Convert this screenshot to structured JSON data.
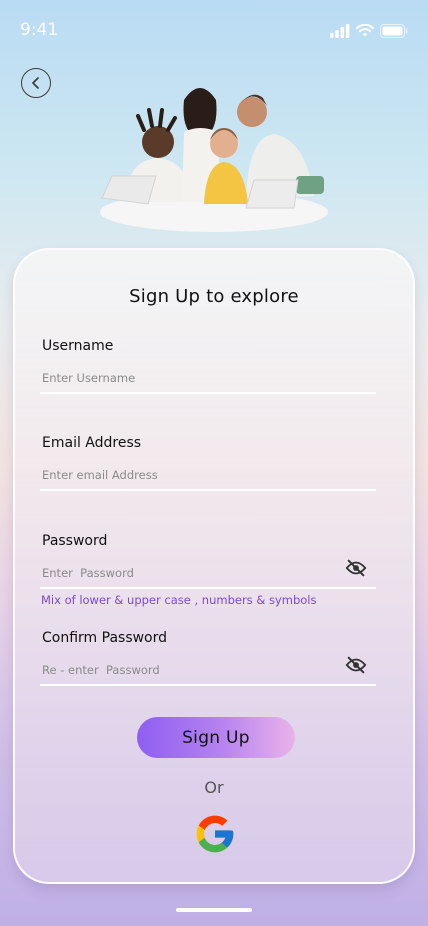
{
  "status_bar": {
    "time": "9:41"
  },
  "header": {
    "back_icon": "chevron-left-icon"
  },
  "form": {
    "title": "Sign Up to explore",
    "username": {
      "label": "Username",
      "placeholder": "Enter Username",
      "value": ""
    },
    "email": {
      "label": "Email Address",
      "placeholder": "Enter email Address",
      "value": ""
    },
    "password": {
      "label": "Password",
      "placeholder": "Enter  Password",
      "value": "",
      "hint": "Mix of lower & upper case , numbers & symbols",
      "visibility_icon": "eye-off-icon"
    },
    "confirm_password": {
      "label": "Confirm Password",
      "placeholder": "Re - enter  Password",
      "value": "",
      "visibility_icon": "eye-off-icon"
    },
    "submit_label": "Sign Up",
    "divider_text": "Or",
    "social_icon": "google-icon"
  },
  "colors": {
    "accent": "#8d5ef2",
    "hint": "#7b48d6"
  }
}
